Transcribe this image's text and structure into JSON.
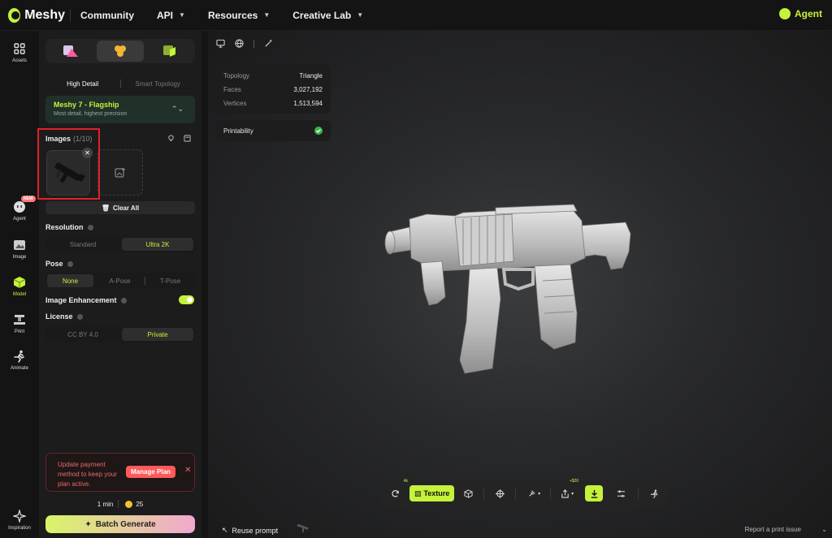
{
  "topbar": {
    "brand": "Meshy",
    "nav": [
      {
        "label": "Community",
        "dropdown": false
      },
      {
        "label": "API",
        "dropdown": true
      },
      {
        "label": "Resources",
        "dropdown": true
      },
      {
        "label": "Creative Lab",
        "dropdown": true
      }
    ],
    "agent_label": "Agent"
  },
  "rail": {
    "assets": "Assets",
    "agent": "Agent",
    "new_badge": "NEW",
    "image": "Image",
    "model": "Model",
    "print": "Print",
    "animate": "Animate",
    "inspiration": "Inspiration"
  },
  "panel": {
    "detail_modes": [
      "High Detail",
      "Smart Topology"
    ],
    "model": {
      "name": "Meshy 7 - Flagship",
      "desc": "Most detail, highest precision"
    },
    "images_label": "Images",
    "images_count": "(1/10)",
    "clear_all": "Clear All",
    "resolution_label": "Resolution",
    "resolution_options": [
      "Standard",
      "Ultra 2K"
    ],
    "pose_label": "Pose",
    "pose_options": [
      "None",
      "A-Pose",
      "T-Pose"
    ],
    "image_enhancement_label": "Image Enhancement",
    "image_enhancement_on": true,
    "license_label": "License",
    "license_options": [
      "CC BY 4.0",
      "Private"
    ],
    "payment_text": "Update payment method to keep your plan active.",
    "manage_plan": "Manage Plan",
    "time": "1 min",
    "credits": "25",
    "batch_generate": "Batch Generate"
  },
  "viewport": {
    "stats": [
      {
        "k": "Topology",
        "v": "Triangle"
      },
      {
        "k": "Faces",
        "v": "3,027,192"
      },
      {
        "k": "Vertices",
        "v": "1,513,594"
      }
    ],
    "printability": "Printability",
    "texture_label": "Texture",
    "remesh_sup": "4k",
    "export_sup": "+$20",
    "reuse_prompt": "Reuse prompt",
    "report": "Report a print issue"
  },
  "colors": {
    "accent": "#c5f23a",
    "danger": "#e0202a",
    "bg": "#141414"
  }
}
